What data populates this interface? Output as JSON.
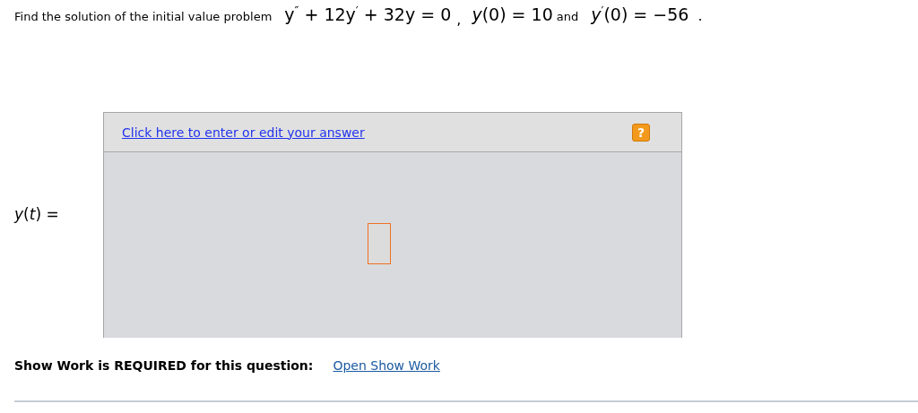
{
  "question": {
    "prompt": "Find the solution of the initial value problem",
    "equation": "y$^{″}$ + 12y$^{′}$ + 32y = 0",
    "separator": ",",
    "condition_1": "*y*(0) = 10",
    "conjunction": "and",
    "condition_2": "*y*$^{′}$(0) = −56",
    "end": "."
  },
  "answer": {
    "label": "*y*(*t*) =",
    "edit_link": "Click here to enter or edit your answer",
    "help": "?"
  },
  "show_work": {
    "text": "Show Work is REQUIRED for this question:",
    "link": "Open Show Work"
  }
}
